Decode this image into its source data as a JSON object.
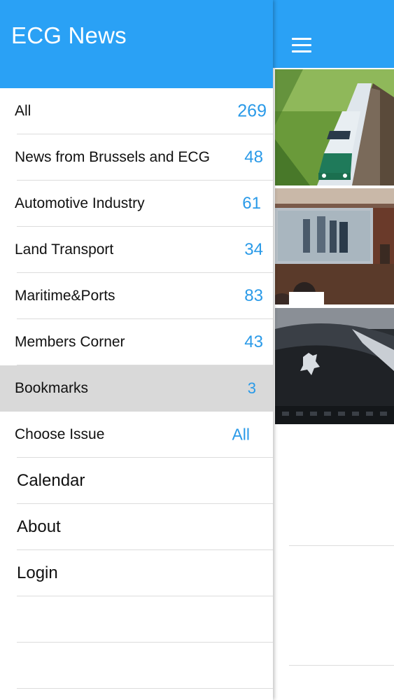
{
  "drawer": {
    "title": "ECG News",
    "items": [
      {
        "label": "All",
        "count": "269"
      },
      {
        "label": "News from Brussels and ECG",
        "count": "48"
      },
      {
        "label": "Automotive Industry",
        "count": "61"
      },
      {
        "label": "Land Transport",
        "count": "34"
      },
      {
        "label": "Maritime&Ports",
        "count": "83"
      },
      {
        "label": "Members Corner",
        "count": "43"
      },
      {
        "label": "Bookmarks",
        "count": "3"
      },
      {
        "label": "Choose Issue",
        "count": "All"
      }
    ],
    "links": [
      {
        "label": "Calendar"
      },
      {
        "label": "About"
      },
      {
        "label": "Login"
      }
    ]
  },
  "colors": {
    "accent": "#2aa1f5",
    "count": "#2a9ae8",
    "active_row": "#d9d9d9"
  },
  "main": {
    "menu_icon": "hamburger-menu-icon",
    "thumbnails": [
      {
        "name": "train-photo"
      },
      {
        "name": "conference-photo"
      },
      {
        "name": "peugeot-car-photo"
      }
    ]
  }
}
